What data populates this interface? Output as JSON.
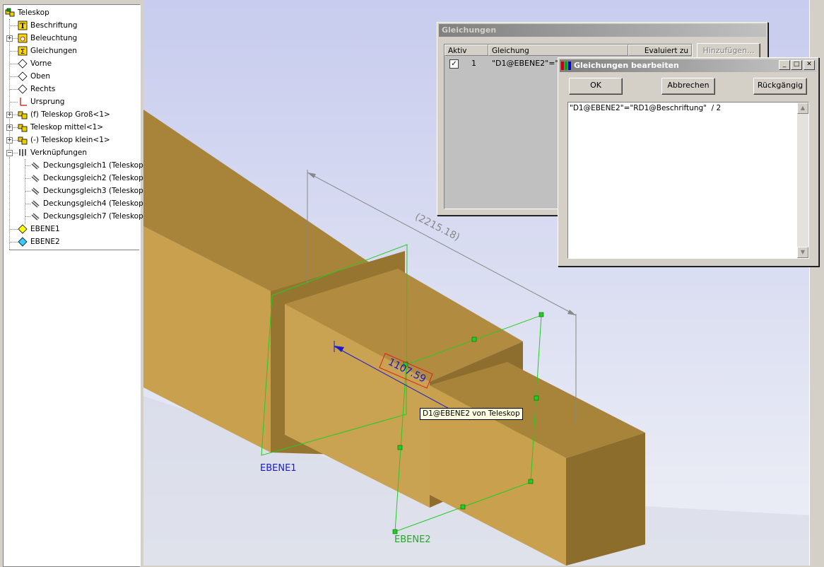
{
  "feature_tree": {
    "root": "Teleskop",
    "items": [
      {
        "label": "Beschriftung",
        "icon": "annotation-icon"
      },
      {
        "label": "Beleuchtung",
        "icon": "lighting-icon"
      },
      {
        "label": "Gleichungen",
        "icon": "equations-icon"
      },
      {
        "label": "Vorne",
        "icon": "plane-icon"
      },
      {
        "label": "Oben",
        "icon": "plane-icon"
      },
      {
        "label": "Rechts",
        "icon": "plane-icon"
      },
      {
        "label": "Ursprung",
        "icon": "origin-icon"
      },
      {
        "label": "(f) Teleskop Groß<1>",
        "icon": "part-icon"
      },
      {
        "label": "Teleskop mittel<1>",
        "icon": "part-icon"
      },
      {
        "label": "(-) Teleskop klein<1>",
        "icon": "part-icon"
      },
      {
        "label": "Verknüpfungen",
        "icon": "mates-icon"
      },
      {
        "label": "Deckungsgleich1 (Teleskop",
        "icon": "mate-icon"
      },
      {
        "label": "Deckungsgleich2 (Teleskop",
        "icon": "mate-icon"
      },
      {
        "label": "Deckungsgleich3 (Teleskop",
        "icon": "mate-icon"
      },
      {
        "label": "Deckungsgleich4 (Teleskop",
        "icon": "mate-icon"
      },
      {
        "label": "Deckungsgleich7 (Teleskop",
        "icon": "mate-icon"
      },
      {
        "label": "EBENE1",
        "icon": "plane-yellow-icon"
      },
      {
        "label": "EBENE2",
        "icon": "plane-cyan-icon"
      }
    ]
  },
  "equations_dialog": {
    "title": "Gleichungen",
    "columns": [
      "Aktiv",
      "Gleichung",
      "Evaluiert zu"
    ],
    "add_button": "Hinzufügen...",
    "rows": [
      {
        "checked": true,
        "index": "1",
        "equation": "\"D1@EBENE2\"=\"F"
      }
    ]
  },
  "edit_dialog": {
    "title": "Gleichungen bearbeiten",
    "ok": "OK",
    "cancel": "Abbrechen",
    "undo": "Rückgängig",
    "text": "\"D1@EBENE2\"=\"RD1@Beschriftung\"  / 2"
  },
  "viewport": {
    "dimension_total": "(2215.18)",
    "dimension_active": "1107.59",
    "tooltip": "D1@EBENE2 von Teleskop",
    "plane1": "EBENE1",
    "plane2": "EBENE2",
    "colors": {
      "wood_top": "#a8843a",
      "wood_front": "#c8a04e",
      "wood_end": "#8c6d2c",
      "plane": "#22cc22",
      "dimension": "#1a1acc"
    }
  }
}
